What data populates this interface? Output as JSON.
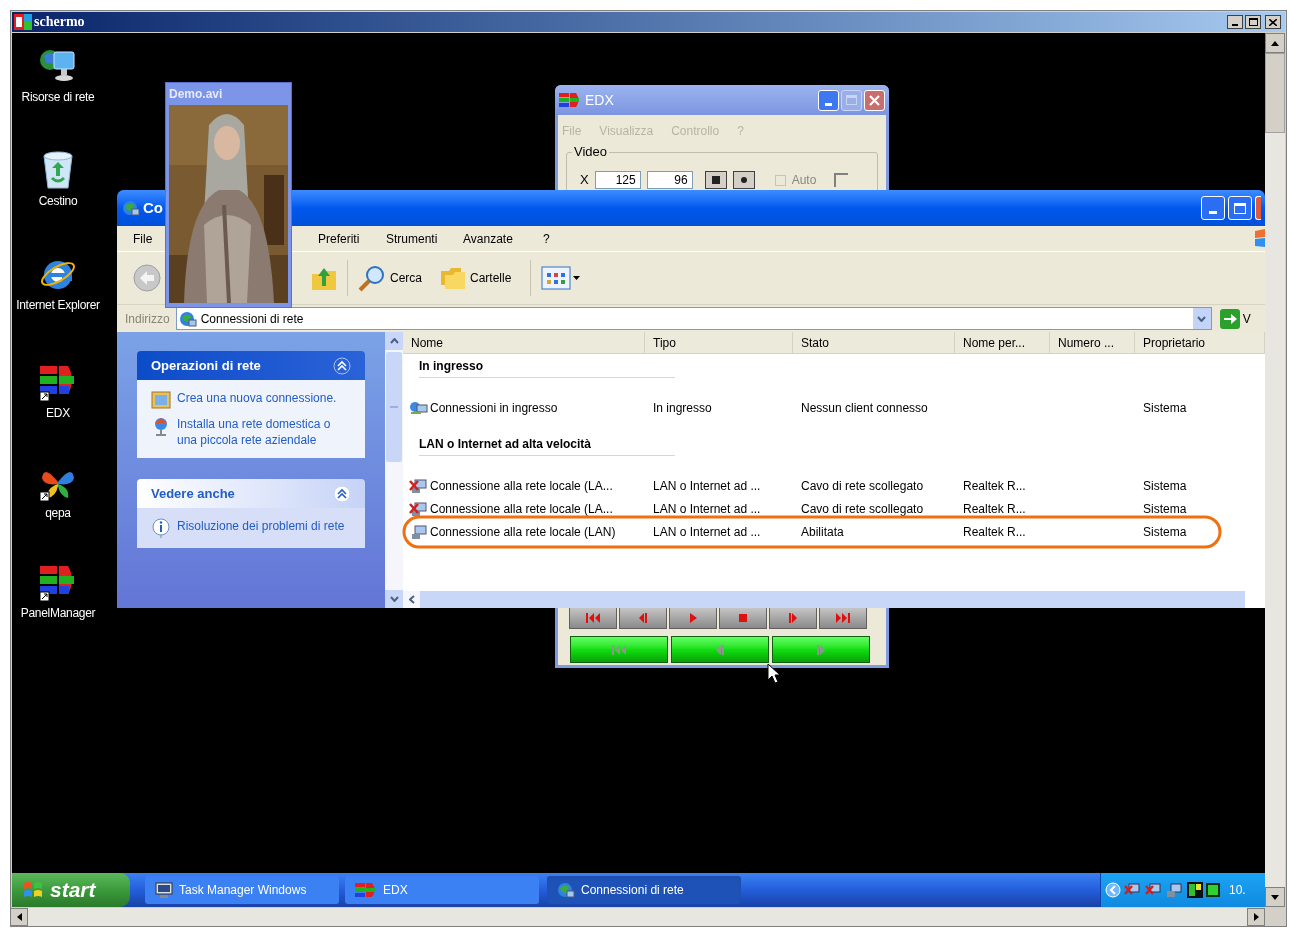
{
  "viewer_window": {
    "title": "schermo"
  },
  "desktop_icons": [
    {
      "label": "Risorse di rete",
      "kind": "network"
    },
    {
      "label": "Cestino",
      "kind": "recycle"
    },
    {
      "label": "Internet Explorer",
      "kind": "ie"
    },
    {
      "label": "EDX",
      "kind": "edx"
    },
    {
      "label": "qepa",
      "kind": "butterfly"
    },
    {
      "label": "PanelManager",
      "kind": "edx"
    }
  ],
  "edx_window": {
    "title": "EDX",
    "menu": [
      {
        "label": "File",
        "disabled": true
      },
      {
        "label": "Visualizza",
        "disabled": true
      },
      {
        "label": "Controllo",
        "disabled": true
      },
      {
        "label": "?",
        "disabled": true
      }
    ],
    "group_label": "Video",
    "x_label": "X",
    "x_value": "125",
    "y_value": "96",
    "auto": {
      "label": "Auto",
      "checked": false,
      "disabled": true
    }
  },
  "explorer_window": {
    "title": "Co",
    "menu": [
      "File",
      "Preferiti",
      "Strumenti",
      "Avanzate",
      "?"
    ],
    "toolbar": [
      {
        "label": "Cerca",
        "kind": "search"
      },
      {
        "label": "Cartelle",
        "kind": "folders"
      }
    ],
    "address_label": "Indirizzo",
    "address": "Connessioni di rete",
    "go_label": "V",
    "task_panes": [
      {
        "title": "Operazioni di rete",
        "kind": "primary",
        "links": [
          {
            "label": "Crea una nuova connessione.",
            "kind": "new"
          },
          {
            "label": "Installa una rete domestica o una piccola rete aziendale",
            "kind": "home"
          }
        ]
      },
      {
        "title": "Vedere anche",
        "kind": "secondary",
        "links": [
          {
            "label": "Risoluzione dei problemi di rete",
            "kind": "help"
          }
        ]
      }
    ],
    "columns": [
      "Nome",
      "Tipo",
      "Stato",
      "Nome per...",
      "Numero ...",
      "Proprietario"
    ],
    "groups": [
      {
        "title": "In ingresso",
        "rows": [
          {
            "kind": "incoming",
            "name": "Connessioni in ingresso",
            "type": "In ingresso",
            "status": "Nessun client connesso",
            "owner": "Sistema"
          }
        ]
      },
      {
        "title": "LAN o Internet ad alta velocità",
        "rows": [
          {
            "kind": "lan_disconnected",
            "name": "Connessione alla rete locale (LA...",
            "type": "LAN o Internet ad ...",
            "status": "Cavo di rete scollegato",
            "column_4": "Realtek R...",
            "owner": "Sistema"
          },
          {
            "kind": "lan_disconnected",
            "name": "Connessione alla rete locale (LA...",
            "type": "LAN o Internet ad ...",
            "status": "Cavo di rete scollegato",
            "column_4": "Realtek R...",
            "owner": "Sistema"
          },
          {
            "kind": "lan",
            "name": "Connessione alla rete locale (LAN)",
            "type": "LAN o Internet ad ...",
            "status": "Abilitata",
            "column_4": "Realtek R...",
            "owner": "Sistema"
          }
        ]
      }
    ]
  },
  "demo_window": {
    "title": "Demo.avi"
  },
  "taskbar": {
    "start": "start",
    "tasks": [
      {
        "label": "Task Manager Windows",
        "kind": "monitor",
        "selected": false
      },
      {
        "label": "EDX",
        "kind": "edx",
        "selected": false
      },
      {
        "label": "Connessioni di rete",
        "kind": "network",
        "selected": true
      }
    ],
    "clock": "10."
  }
}
